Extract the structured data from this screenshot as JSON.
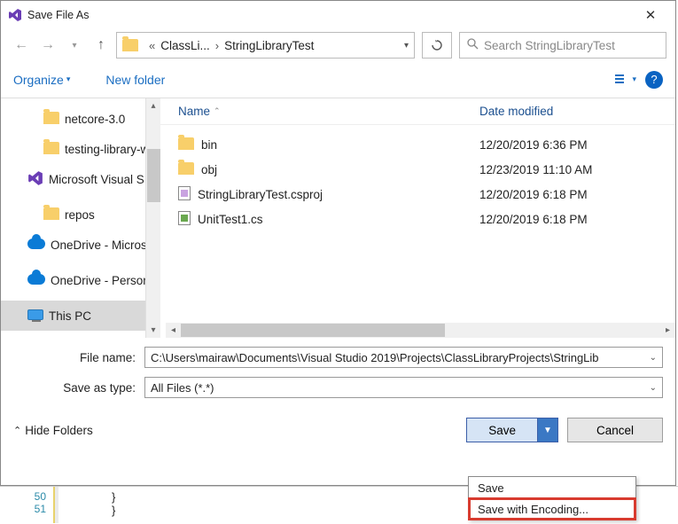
{
  "window": {
    "title": "Save File As"
  },
  "nav": {
    "crumb1": "ClassLi...",
    "crumb2": "StringLibraryTest",
    "search_placeholder": "Search StringLibraryTest"
  },
  "toolbar": {
    "organize": "Organize",
    "newfolder": "New folder",
    "help": "?"
  },
  "tree": {
    "items": [
      {
        "label": "netcore-3.0",
        "icon": "folder",
        "indent": "l2"
      },
      {
        "label": "testing-library-w",
        "icon": "folder",
        "indent": "l2"
      },
      {
        "label": "Microsoft Visual S",
        "icon": "vs",
        "indent": ""
      },
      {
        "label": "repos",
        "icon": "folder",
        "indent": "l2"
      },
      {
        "label": "OneDrive - Micros",
        "icon": "cloud",
        "indent": ""
      },
      {
        "label": "OneDrive - Person",
        "icon": "cloud",
        "indent": ""
      },
      {
        "label": "This PC",
        "icon": "pc",
        "indent": "",
        "selected": true
      }
    ]
  },
  "columns": {
    "name": "Name",
    "date": "Date modified"
  },
  "files": [
    {
      "name": "bin",
      "icon": "folder",
      "date": "12/20/2019 6:36 PM"
    },
    {
      "name": "obj",
      "icon": "folder",
      "date": "12/23/2019 11:10 AM"
    },
    {
      "name": "StringLibraryTest.csproj",
      "icon": "csproj",
      "date": "12/20/2019 6:18 PM"
    },
    {
      "name": "UnitTest1.cs",
      "icon": "cs",
      "date": "12/20/2019 6:18 PM"
    }
  ],
  "fields": {
    "filename_label": "File name:",
    "filename_value": "C:\\Users\\mairaw\\Documents\\Visual Studio 2019\\Projects\\ClassLibraryProjects\\StringLib",
    "saveas_label": "Save as type:",
    "saveas_value": "All Files (*.*)"
  },
  "footer": {
    "hidefolders": "Hide Folders",
    "save": "Save",
    "cancel": "Cancel"
  },
  "dropdown": {
    "items": [
      {
        "label": "Save"
      },
      {
        "label": "Save with Encoding...",
        "highlight": true
      }
    ]
  },
  "code": {
    "line1_no": "50",
    "line1": "}",
    "line2_no": "51",
    "line2": "}"
  }
}
